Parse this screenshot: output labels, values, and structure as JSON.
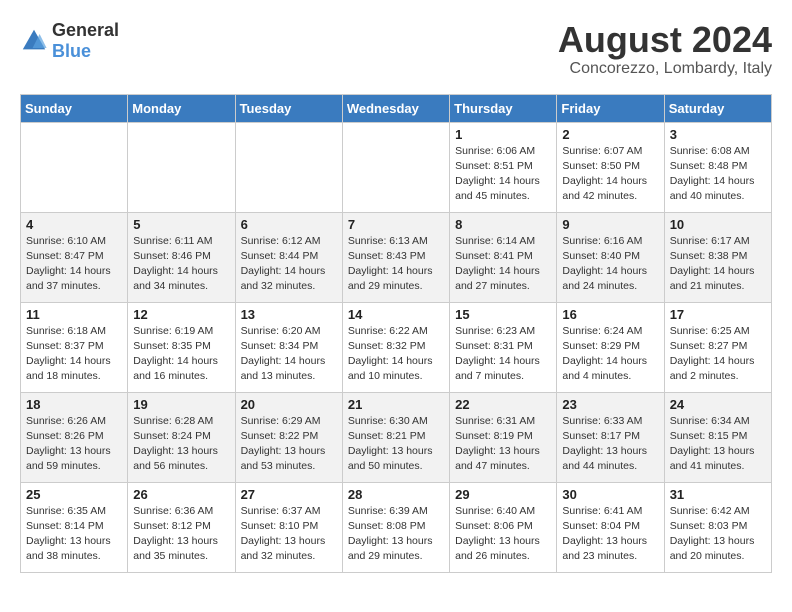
{
  "header": {
    "logo_general": "General",
    "logo_blue": "Blue",
    "month_year": "August 2024",
    "location": "Concorezzo, Lombardy, Italy"
  },
  "days_of_week": [
    "Sunday",
    "Monday",
    "Tuesday",
    "Wednesday",
    "Thursday",
    "Friday",
    "Saturday"
  ],
  "weeks": [
    [
      {
        "day": "",
        "info": ""
      },
      {
        "day": "",
        "info": ""
      },
      {
        "day": "",
        "info": ""
      },
      {
        "day": "",
        "info": ""
      },
      {
        "day": "1",
        "info": "Sunrise: 6:06 AM\nSunset: 8:51 PM\nDaylight: 14 hours\nand 45 minutes."
      },
      {
        "day": "2",
        "info": "Sunrise: 6:07 AM\nSunset: 8:50 PM\nDaylight: 14 hours\nand 42 minutes."
      },
      {
        "day": "3",
        "info": "Sunrise: 6:08 AM\nSunset: 8:48 PM\nDaylight: 14 hours\nand 40 minutes."
      }
    ],
    [
      {
        "day": "4",
        "info": "Sunrise: 6:10 AM\nSunset: 8:47 PM\nDaylight: 14 hours\nand 37 minutes."
      },
      {
        "day": "5",
        "info": "Sunrise: 6:11 AM\nSunset: 8:46 PM\nDaylight: 14 hours\nand 34 minutes."
      },
      {
        "day": "6",
        "info": "Sunrise: 6:12 AM\nSunset: 8:44 PM\nDaylight: 14 hours\nand 32 minutes."
      },
      {
        "day": "7",
        "info": "Sunrise: 6:13 AM\nSunset: 8:43 PM\nDaylight: 14 hours\nand 29 minutes."
      },
      {
        "day": "8",
        "info": "Sunrise: 6:14 AM\nSunset: 8:41 PM\nDaylight: 14 hours\nand 27 minutes."
      },
      {
        "day": "9",
        "info": "Sunrise: 6:16 AM\nSunset: 8:40 PM\nDaylight: 14 hours\nand 24 minutes."
      },
      {
        "day": "10",
        "info": "Sunrise: 6:17 AM\nSunset: 8:38 PM\nDaylight: 14 hours\nand 21 minutes."
      }
    ],
    [
      {
        "day": "11",
        "info": "Sunrise: 6:18 AM\nSunset: 8:37 PM\nDaylight: 14 hours\nand 18 minutes."
      },
      {
        "day": "12",
        "info": "Sunrise: 6:19 AM\nSunset: 8:35 PM\nDaylight: 14 hours\nand 16 minutes."
      },
      {
        "day": "13",
        "info": "Sunrise: 6:20 AM\nSunset: 8:34 PM\nDaylight: 14 hours\nand 13 minutes."
      },
      {
        "day": "14",
        "info": "Sunrise: 6:22 AM\nSunset: 8:32 PM\nDaylight: 14 hours\nand 10 minutes."
      },
      {
        "day": "15",
        "info": "Sunrise: 6:23 AM\nSunset: 8:31 PM\nDaylight: 14 hours\nand 7 minutes."
      },
      {
        "day": "16",
        "info": "Sunrise: 6:24 AM\nSunset: 8:29 PM\nDaylight: 14 hours\nand 4 minutes."
      },
      {
        "day": "17",
        "info": "Sunrise: 6:25 AM\nSunset: 8:27 PM\nDaylight: 14 hours\nand 2 minutes."
      }
    ],
    [
      {
        "day": "18",
        "info": "Sunrise: 6:26 AM\nSunset: 8:26 PM\nDaylight: 13 hours\nand 59 minutes."
      },
      {
        "day": "19",
        "info": "Sunrise: 6:28 AM\nSunset: 8:24 PM\nDaylight: 13 hours\nand 56 minutes."
      },
      {
        "day": "20",
        "info": "Sunrise: 6:29 AM\nSunset: 8:22 PM\nDaylight: 13 hours\nand 53 minutes."
      },
      {
        "day": "21",
        "info": "Sunrise: 6:30 AM\nSunset: 8:21 PM\nDaylight: 13 hours\nand 50 minutes."
      },
      {
        "day": "22",
        "info": "Sunrise: 6:31 AM\nSunset: 8:19 PM\nDaylight: 13 hours\nand 47 minutes."
      },
      {
        "day": "23",
        "info": "Sunrise: 6:33 AM\nSunset: 8:17 PM\nDaylight: 13 hours\nand 44 minutes."
      },
      {
        "day": "24",
        "info": "Sunrise: 6:34 AM\nSunset: 8:15 PM\nDaylight: 13 hours\nand 41 minutes."
      }
    ],
    [
      {
        "day": "25",
        "info": "Sunrise: 6:35 AM\nSunset: 8:14 PM\nDaylight: 13 hours\nand 38 minutes."
      },
      {
        "day": "26",
        "info": "Sunrise: 6:36 AM\nSunset: 8:12 PM\nDaylight: 13 hours\nand 35 minutes."
      },
      {
        "day": "27",
        "info": "Sunrise: 6:37 AM\nSunset: 8:10 PM\nDaylight: 13 hours\nand 32 minutes."
      },
      {
        "day": "28",
        "info": "Sunrise: 6:39 AM\nSunset: 8:08 PM\nDaylight: 13 hours\nand 29 minutes."
      },
      {
        "day": "29",
        "info": "Sunrise: 6:40 AM\nSunset: 8:06 PM\nDaylight: 13 hours\nand 26 minutes."
      },
      {
        "day": "30",
        "info": "Sunrise: 6:41 AM\nSunset: 8:04 PM\nDaylight: 13 hours\nand 23 minutes."
      },
      {
        "day": "31",
        "info": "Sunrise: 6:42 AM\nSunset: 8:03 PM\nDaylight: 13 hours\nand 20 minutes."
      }
    ]
  ]
}
